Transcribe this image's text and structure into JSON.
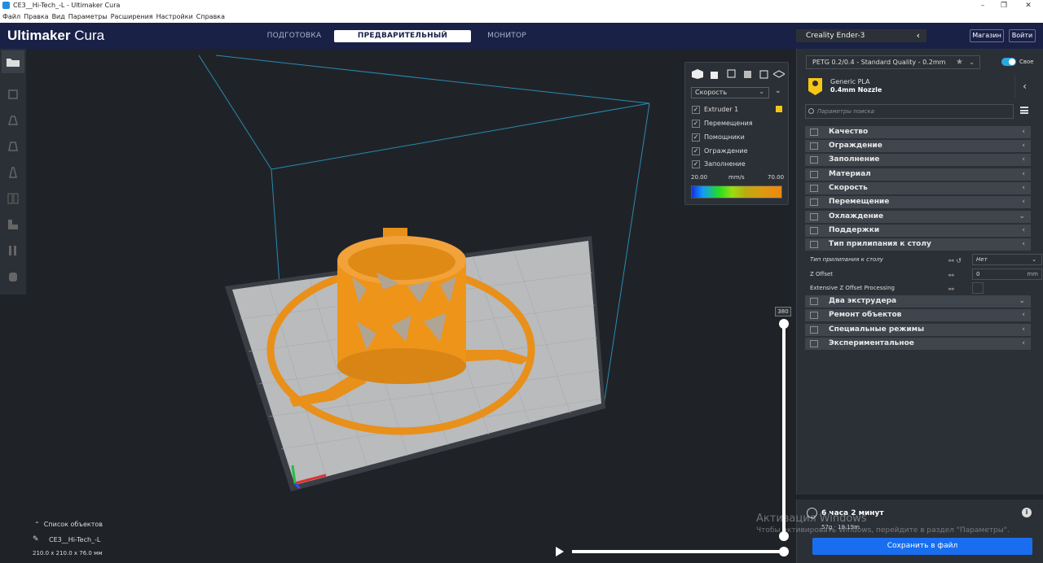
{
  "window": {
    "title": "CE3__Hi-Tech_-L - Ultimaker Cura",
    "minimize": "–",
    "maximize": "❐",
    "close": "✕"
  },
  "menu": [
    "Файл",
    "Правка",
    "Вид",
    "Параметры",
    "Расширения",
    "Настройки",
    "Справка"
  ],
  "header": {
    "logo_bold": "Ultimaker",
    "logo_light": " Cura",
    "tabs": [
      "ПОДГОТОВКА",
      "ПРЕДВАРИТЕЛЬНЫЙ ПРОСМОТР",
      "МОНИТОР"
    ],
    "printer": "Creality Ender-3",
    "marketplace": "Магазин",
    "signin": "Войти"
  },
  "view_panel": {
    "color_scheme": "Скорость",
    "checks": [
      "Extruder 1",
      "Перемещения",
      "Помощники",
      "Ограждение",
      "Заполнение"
    ],
    "legend_min": "20.00",
    "legend_unit": "mm/s",
    "legend_max": "70.00"
  },
  "settings": {
    "profile": "PETG 0.2/0.4 - Standard Quality - 0.2mm",
    "custom_label": "Свое",
    "material_name": "Generic PLA",
    "nozzle": "0.4mm Nozzle",
    "search_placeholder": "Параметры поиска",
    "categories": [
      {
        "label": "Качество",
        "chev": "‹"
      },
      {
        "label": "Ограждение",
        "chev": "‹"
      },
      {
        "label": "Заполнение",
        "chev": "‹"
      },
      {
        "label": "Материал",
        "chev": "‹"
      },
      {
        "label": "Скорость",
        "chev": "‹"
      },
      {
        "label": "Перемещение",
        "chev": "‹"
      },
      {
        "label": "Охлаждение",
        "chev": "⌄"
      },
      {
        "label": "Поддержки",
        "chev": "‹"
      },
      {
        "label": "Тип прилипания к столу",
        "chev": "‹"
      }
    ],
    "adhesion_rows": [
      {
        "label": "Тип прилипания к столу",
        "value": "Нет"
      },
      {
        "label": "Z Offset",
        "value": "0",
        "unit": "mm"
      },
      {
        "label": "Extensive Z Offset Processing",
        "value": ""
      }
    ],
    "categories2": [
      {
        "label": "Два экструдера",
        "chev": "⌄"
      },
      {
        "label": "Ремонт объектов",
        "chev": "‹"
      },
      {
        "label": "Специальные режимы",
        "chev": "‹"
      },
      {
        "label": "Экспериментальное",
        "chev": "‹"
      }
    ]
  },
  "print": {
    "time": "6 часа 2 минут",
    "material": "57g · 19.19m",
    "save": "Сохранить в файл"
  },
  "layer": {
    "current": "380"
  },
  "objects": {
    "header": "Список объектов",
    "item": "CE3__Hi-Tech_-L",
    "dims": "210.0 x 210.0 x 76.0 мм"
  },
  "watermark": {
    "title": "Активация Windows",
    "text": "Чтобы активировать Windows, перейдите в раздел \"Параметры\"."
  }
}
